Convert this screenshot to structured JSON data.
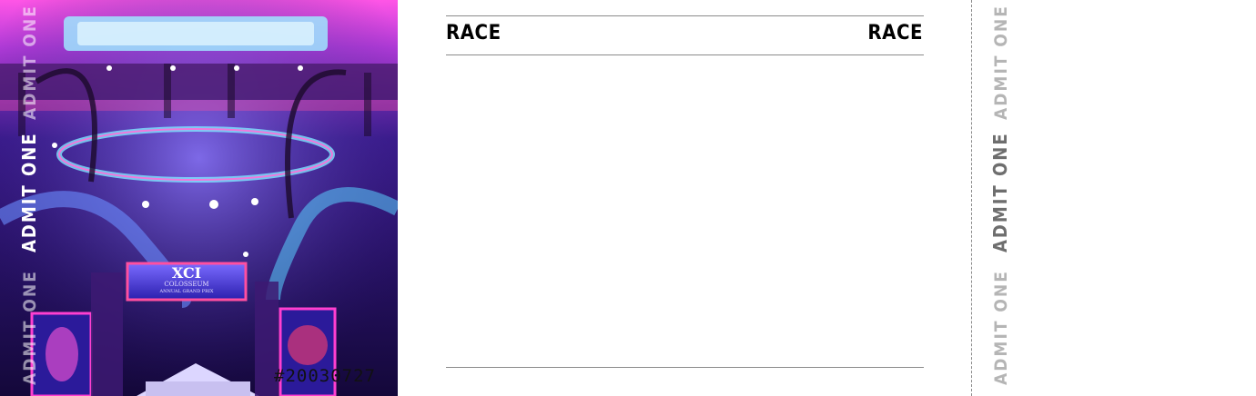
{
  "ticket": {
    "header": {
      "left_label": "RACE",
      "right_label": "RACE"
    },
    "art_panel": {
      "admit_labels": [
        "ADMIT ONE",
        "ADMIT ONE",
        "ADMIT ONE"
      ],
      "sign_title": "XCI",
      "sign_subtitle": "COLOSSEUM",
      "sign_tagline": "ANNUAL GRAND PRIX",
      "serial": "#20030727"
    },
    "stub": {
      "admit_labels": [
        "ADMIT ONE",
        "ADMIT ONE",
        "ADMIT ONE"
      ]
    },
    "colors": {
      "rule": "#8a8a8a",
      "stub_text_light": "#b5b5b5",
      "stub_text_dark": "#6e6e6e",
      "art_base": "#1a0b4d",
      "neon_pink": "#ff3fd0",
      "neon_cyan": "#6fe9ff"
    }
  }
}
